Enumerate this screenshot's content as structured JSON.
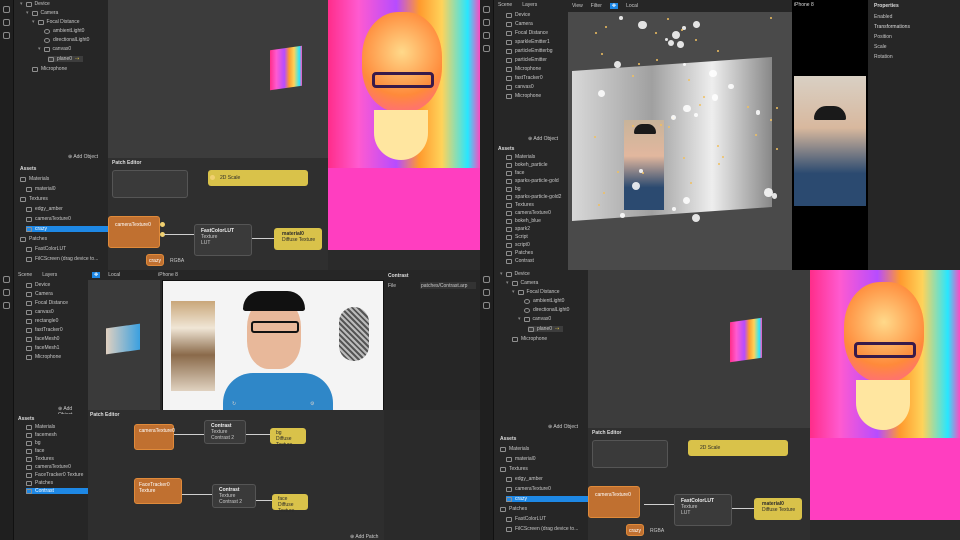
{
  "panes": {
    "q1": {
      "scene_tree": [
        "Device",
        "Camera",
        "Focal Distance",
        "ambientLight0",
        "directionalLight0",
        "canvas0",
        "plane0",
        "Microphone"
      ],
      "add_object": "Add Object",
      "assets_title": "Assets",
      "assets": [
        {
          "label": "Materials",
          "kind": "folder"
        },
        {
          "label": "material0",
          "kind": "item"
        },
        {
          "label": "Textures",
          "kind": "folder"
        },
        {
          "label": "edgy_amber",
          "kind": "item"
        },
        {
          "label": "cameraTexture0",
          "kind": "item"
        },
        {
          "label": "crazy",
          "kind": "item",
          "selected": true
        },
        {
          "label": "Patches",
          "kind": "folder"
        },
        {
          "label": "FastColorLUT",
          "kind": "item"
        },
        {
          "label": "FilCScreen (drag device to...",
          "kind": "item"
        }
      ],
      "patch_editor": "Patch Editor",
      "nodes": {
        "scale_label": "2D Scale",
        "camera_texture": "cameraTexture0",
        "lut_title": "FastColorLUT",
        "lut_texture": "Texture",
        "lut_lut": "LUT",
        "material": "material0",
        "diffuse": "Diffuse Texture",
        "crazy": "crazy",
        "rgba": "RGBA"
      }
    },
    "q2": {
      "scene_label": "Scene",
      "layers_label": "Layers",
      "scene_tree": [
        "Device",
        "Camera",
        "Focal Distance",
        "sparkleEmitter1",
        "particleEmitterbg",
        "particleEmitter",
        "Microphone",
        "fastTracker0",
        "canvas0",
        "Microphone"
      ],
      "add_object": "Add Object",
      "assets_title": "Assets",
      "assets": [
        "Materials",
        "bokeh_particle",
        "face",
        "sparks-particle-gold",
        "bg",
        "sparks-particle-gold2",
        "Textures",
        "cameraTexture0",
        "bokeh_blue",
        "spark2",
        "Script",
        "script0",
        "Patches",
        "Contrast"
      ],
      "toolbar": {
        "view": "View",
        "filter": "Filter",
        "local": "Local",
        "device": "iPhone 8"
      },
      "properties_title": "Properties",
      "properties": [
        "Enabled",
        "Transformations",
        "Position",
        "Scale",
        "Rotation"
      ]
    },
    "q3": {
      "scene_label": "Scene",
      "layers_label": "Layers",
      "scene_tree": [
        "Device",
        "Camera",
        "Focal Distance",
        "canvas0",
        "rectangle0",
        "fastTracker0",
        "faceMesh0",
        "faceMesh1",
        "Microphone"
      ],
      "device": "iPhone 8",
      "local": "Local",
      "contrast_title": "Contrast",
      "contrast_file_label": "File",
      "contrast_file": "patches/Contrast.arp",
      "add_object": "Add Object",
      "assets_title": "Assets",
      "assets": [
        "Materials",
        "facemesh",
        "bg",
        "face",
        "Textures",
        "cameraTexture0",
        "FaceTracker0 Texture",
        "Patches",
        "Contrast"
      ],
      "patch_editor": "Patch Editor",
      "add_patch": "Add Patch",
      "nodes": {
        "camtex": "cameraTexture0",
        "contrast1": "Contrast",
        "contrast2": "Contrast",
        "texture": "Texture",
        "contrast_port": "Contrast",
        "val2": "2",
        "bg": "bg",
        "diffuse": "Diffuse Texture",
        "facetex": "FaceTracker0 Texture",
        "face": "face"
      }
    },
    "q4": {
      "scene_tree": [
        "Device",
        "Camera",
        "Focal Distance",
        "ambientLight0",
        "directionalLight0",
        "canvas0",
        "plane0",
        "Microphone"
      ],
      "add_object": "Add Object",
      "assets_title": "Assets",
      "assets": [
        {
          "label": "Materials",
          "kind": "folder"
        },
        {
          "label": "material0",
          "kind": "item"
        },
        {
          "label": "Textures",
          "kind": "folder"
        },
        {
          "label": "edgy_amber",
          "kind": "item"
        },
        {
          "label": "cameraTexture0",
          "kind": "item"
        },
        {
          "label": "crazy",
          "kind": "item",
          "selected": true
        },
        {
          "label": "Patches",
          "kind": "folder"
        },
        {
          "label": "FastColorLUT",
          "kind": "item"
        },
        {
          "label": "FilCScreen (drag device to...",
          "kind": "item"
        }
      ],
      "patch_editor": "Patch Editor",
      "nodes": {
        "scale_label": "2D Scale",
        "camera_texture": "cameraTexture0",
        "lut_title": "FastColorLUT",
        "lut_texture": "Texture",
        "lut_lut": "LUT",
        "material": "material0",
        "diffuse": "Diffuse Texture",
        "crazy": "crazy",
        "rgba": "RGBA"
      }
    }
  },
  "colors": {
    "selection": "#1e88e5",
    "node_orange": "#c07030",
    "node_yellow": "#d9c24a",
    "accent_yellow": "#e6c94b"
  }
}
